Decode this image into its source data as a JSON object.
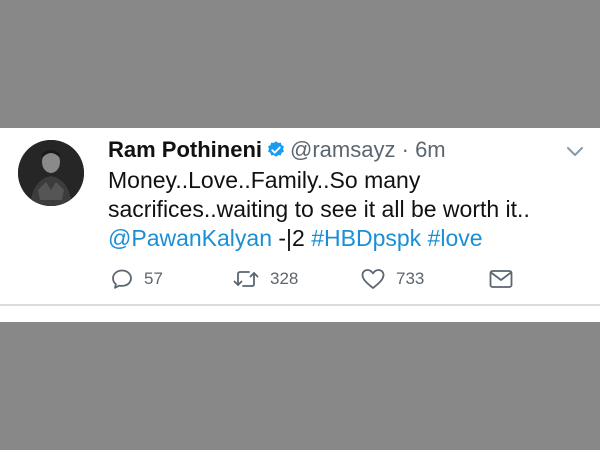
{
  "tweet": {
    "display_name": "Ram Pothineni",
    "handle": "@ramsayz",
    "separator": "·",
    "time": "6m",
    "verified": true,
    "body": {
      "line1": "Money..Love..Family..So many",
      "line2": "sacrifices..waiting to see it all be worth it..",
      "mention": "@PawanKalyan",
      "mid_text": " -|2 ",
      "hashtag1": "#HBDpspk",
      "space": " ",
      "hashtag2": "#love"
    },
    "actions": {
      "reply_count": "57",
      "retweet_count": "328",
      "like_count": "733"
    }
  },
  "colors": {
    "link": "#1b8fd6",
    "verified": "#1d9bf0",
    "muted": "#5b6670",
    "background_gray": "#888888"
  }
}
